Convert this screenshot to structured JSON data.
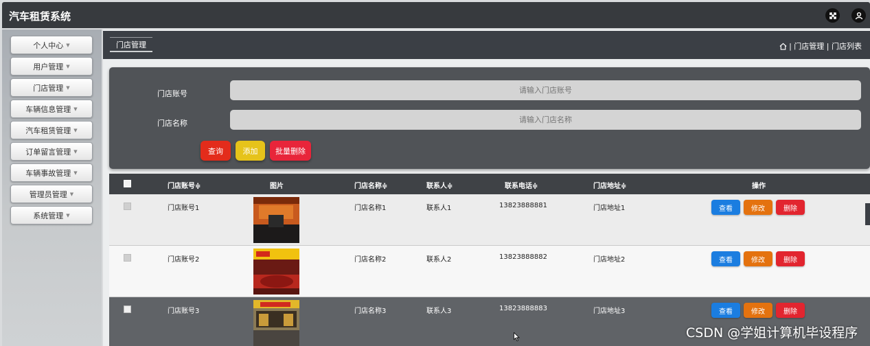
{
  "app": {
    "title": "汽车租赁系统"
  },
  "sidebar": {
    "items": [
      {
        "label": "个人中心"
      },
      {
        "label": "用户管理"
      },
      {
        "label": "门店管理"
      },
      {
        "label": "车辆信息管理"
      },
      {
        "label": "汽车租赁管理"
      },
      {
        "label": "订单留言管理"
      },
      {
        "label": "车辆事故管理"
      },
      {
        "label": "管理员管理"
      },
      {
        "label": "系统管理"
      }
    ]
  },
  "header": {
    "page_title": "门店管理",
    "breadcrumb": "| 门店管理 | 门店列表"
  },
  "search": {
    "account_label": "门店账号",
    "account_placeholder": "请输入门店账号",
    "name_label": "门店名称",
    "name_placeholder": "请输入门店名称",
    "query_label": "查询",
    "add_label": "添加",
    "batch_delete_label": "批量删除"
  },
  "table": {
    "headers": {
      "account": "门店账号≑",
      "image": "图片",
      "name": "门店名称≑",
      "contact": "联系人≑",
      "phone": "联系电话≑",
      "address": "门店地址≑",
      "actions": "操作"
    },
    "rows": [
      {
        "account": "门店账号1",
        "name": "门店名称1",
        "contact": "联系人1",
        "phone": "13823888881",
        "address": "门店地址1"
      },
      {
        "account": "门店账号2",
        "name": "门店名称2",
        "contact": "联系人2",
        "phone": "13823888882",
        "address": "门店地址2"
      },
      {
        "account": "门店账号3",
        "name": "门店名称3",
        "contact": "联系人3",
        "phone": "13823888883",
        "address": "门店地址3"
      }
    ],
    "actions": {
      "view": "查看",
      "edit": "修改",
      "delete": "删除"
    }
  },
  "watermark": "CSDN @学姐计算机毕设程序",
  "colors": {
    "query": "#e32c1b",
    "add": "#e6c31a",
    "batch_delete": "#e8253a",
    "view": "#1b7de0",
    "edit": "#e4720f",
    "delete": "#e2252f"
  }
}
